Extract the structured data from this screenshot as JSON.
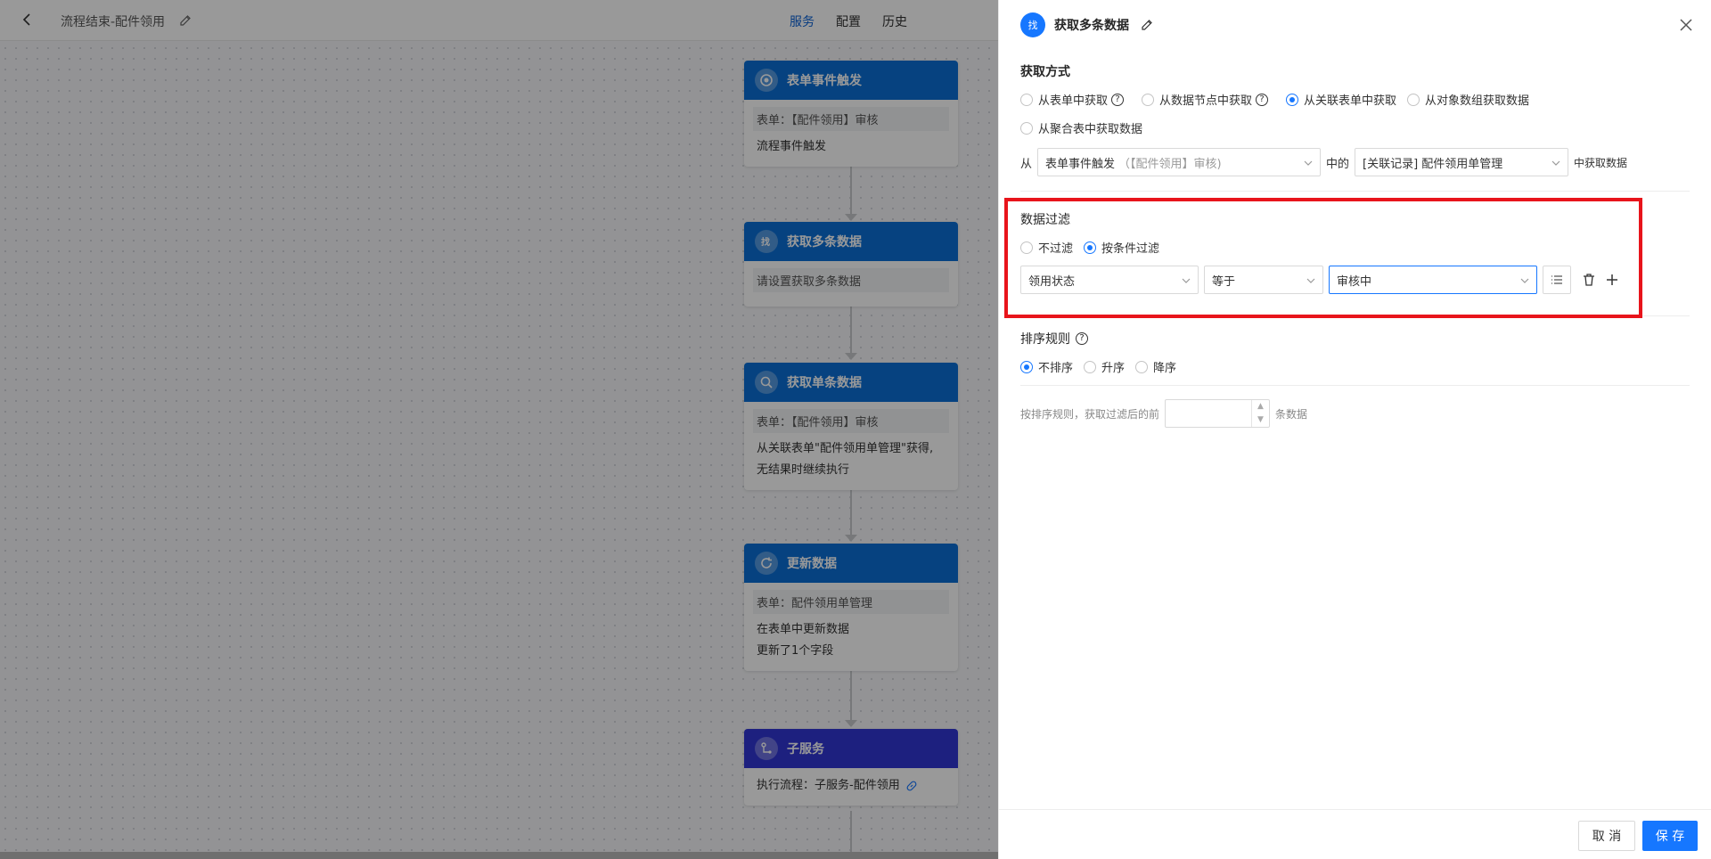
{
  "topbar": {
    "title": "流程结束-配件领用",
    "tabs": [
      {
        "label": "服务",
        "active": true
      },
      {
        "label": "配置",
        "active": false
      },
      {
        "label": "历史",
        "active": false
      }
    ]
  },
  "nodes": [
    {
      "title": "表单事件触发",
      "tag": "表单：【配件领用】审核",
      "lines": [
        "流程事件触发"
      ]
    },
    {
      "title": "获取多条数据",
      "tag": "请设置获取多条数据",
      "lines": []
    },
    {
      "title": "获取单条数据",
      "tag": "表单：【配件领用】审核",
      "lines": [
        "从关联表单\"配件领用单管理\"获得,",
        "无结果时继续执行"
      ]
    },
    {
      "title": "更新数据",
      "tag": "表单：配件领用单管理",
      "lines": [
        "在表单中更新数据",
        "更新了1个字段"
      ]
    },
    {
      "title": "子服务",
      "tag": "",
      "lines": [
        "执行流程：子服务-配件领用"
      ]
    }
  ],
  "panel": {
    "icon_text": "找",
    "title": "获取多条数据",
    "fetch_method": {
      "label": "获取方式",
      "options": [
        {
          "label": "从表单中获取",
          "selected": false,
          "help": true
        },
        {
          "label": "从数据节点中获取",
          "selected": false,
          "help": true
        },
        {
          "label": "从关联表单中获取",
          "selected": true,
          "help": false
        },
        {
          "label": "从对象数组获取数据",
          "selected": false,
          "help": false
        },
        {
          "label": "从聚合表中获取数据",
          "selected": false,
          "help": false
        }
      ]
    },
    "source": {
      "from_label": "从",
      "source_value_main": "表单事件触发",
      "source_value_sub": "（【配件领用】审核)",
      "middle_label": "中的",
      "relation_value": "[关联记录] 配件领用单管理",
      "suffix_label": "中获取数据"
    },
    "filter": {
      "label": "数据过滤",
      "options": [
        {
          "label": "不过滤",
          "selected": false
        },
        {
          "label": "按条件过滤",
          "selected": true
        }
      ],
      "field": "领用状态",
      "operator": "等于",
      "value": "审核中"
    },
    "sort": {
      "label": "排序规则",
      "options": [
        {
          "label": "不排序",
          "selected": true
        },
        {
          "label": "升序",
          "selected": false
        },
        {
          "label": "降序",
          "selected": false
        }
      ]
    },
    "limit": {
      "prefix": "按排序规则，获取过滤后的前",
      "value": "",
      "suffix": "条数据"
    },
    "footer": {
      "cancel_label": "取 消",
      "save_label": "保 存"
    }
  },
  "colors": {
    "primary": "#1677ff",
    "node_blue": "#0b6fd6",
    "node_purple": "#3136d4",
    "highlight": "#e8141b"
  }
}
